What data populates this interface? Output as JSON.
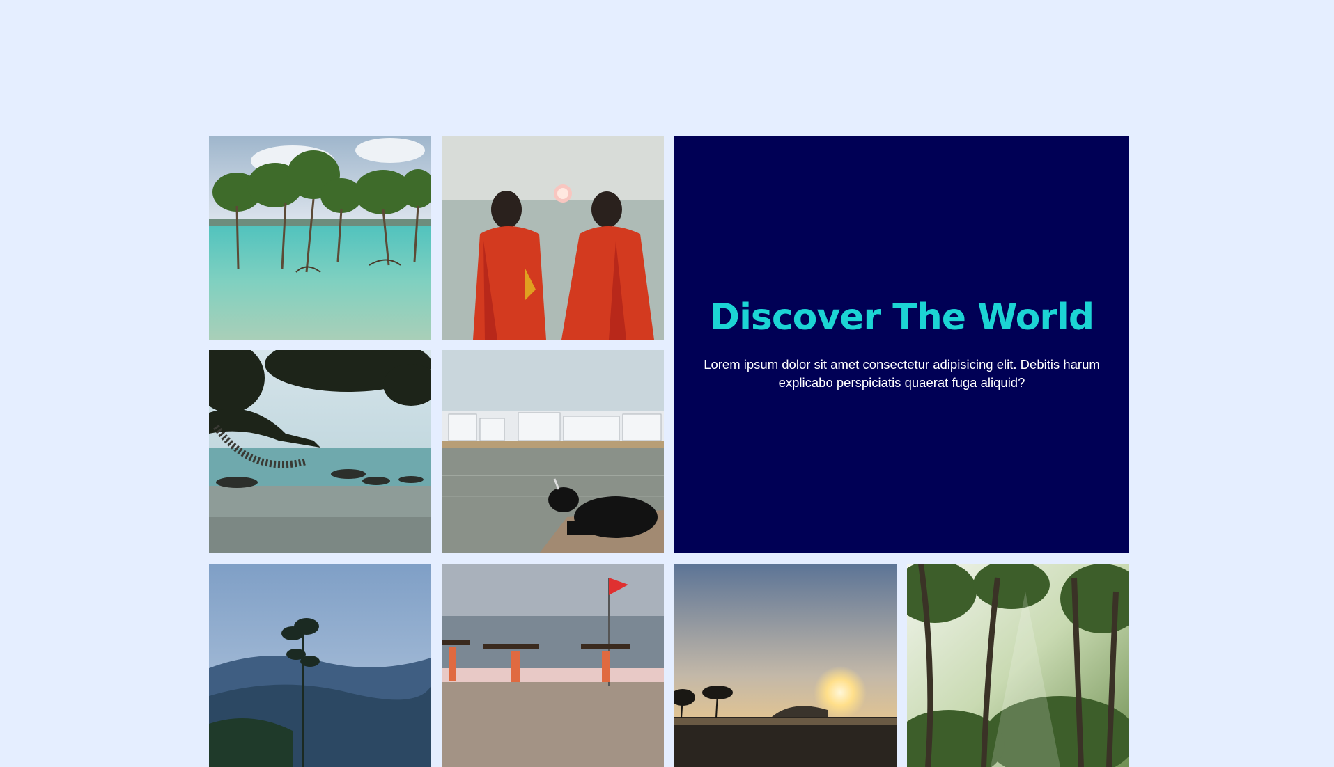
{
  "hero": {
    "title": "Discover The World",
    "description": "Lorem ipsum dolor sit amet consectetur adipisicing elit. Debitis harum explicabo perspiciatis quaerat fuga aliquid?"
  },
  "colors": {
    "page_background": "#e5eeff",
    "hero_background": "#000055",
    "hero_title": "#1cd4d4",
    "hero_text": "#ffffff"
  },
  "gallery": [
    {
      "name": "mangrove-trees-photo"
    },
    {
      "name": "women-in-saris-sunset-photo"
    },
    {
      "name": "beach-hammock-photo"
    },
    {
      "name": "lake-town-cow-photo"
    },
    {
      "name": "misty-mountains-photo"
    },
    {
      "name": "beach-wood-carriers-photo"
    },
    {
      "name": "sunset-horizon-photo"
    },
    {
      "name": "palm-forest-photo"
    }
  ]
}
